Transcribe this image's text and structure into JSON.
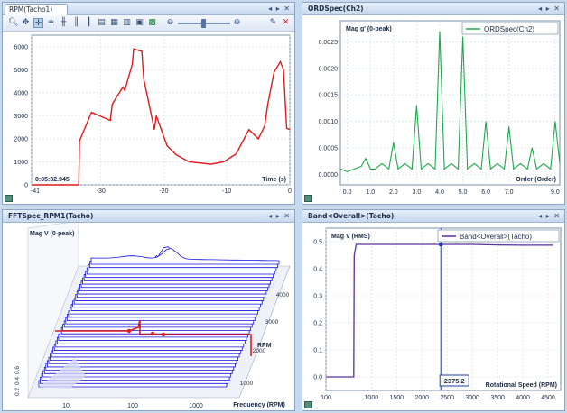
{
  "panes": {
    "rpm": {
      "tab": "RPM(Tacho1)",
      "timestamp": "0:05:32.945",
      "xlabel": "Time (s)",
      "xticks": [
        "-41",
        "-30",
        "-20",
        "-10",
        "0"
      ],
      "yticks": [
        "6000",
        "5000",
        "4000",
        "3000",
        "2000",
        "1000",
        "0"
      ],
      "line_color": "#e01b1b"
    },
    "ord": {
      "tab": "ORDSpec(Ch2)",
      "ylabel": "Mag g' (0-peak)",
      "legend": "ORDSpec(Ch2)",
      "xlabel": "Order (Order)",
      "xticks": [
        "0.0",
        "1.0",
        "2.0",
        "3.0",
        "4.0",
        "5.0",
        "6.0",
        "7.0",
        "9.0"
      ],
      "yticks": [
        "0.0025",
        "0.0020",
        "0.0015",
        "0.0010",
        "0.0005",
        "0.0000"
      ],
      "line_color": "#1ea84a"
    },
    "fft": {
      "tab": "FFTSpec_RPM1(Tacho)",
      "ylabel": "Mag V (0-peak)",
      "xlabel": "Frequency (RPM)",
      "xticks": [
        "10",
        "100",
        "1000"
      ],
      "zlabel": "RPM",
      "zticks": [
        "4000",
        "3000",
        "2000",
        "1000"
      ],
      "yticks": [
        "0.6",
        "0.4",
        "0.2"
      ],
      "waterfall_color": "#1010e0",
      "marker_color": "#e01b1b"
    },
    "band": {
      "tab": "Band<Overall>(Tacho)",
      "ylabel": "Mag V (RMS)",
      "legend": "Band<Overall>(Tacho)",
      "xlabel": "Rotational Speed (RPM)",
      "xticks": [
        "100",
        "1000",
        "1500",
        "2000",
        "2500",
        "3000",
        "3500",
        "4000",
        "4500"
      ],
      "yticks": [
        "0.5",
        "0.4",
        "0.3",
        "0.2",
        "0.1",
        "0.0"
      ],
      "cursor_value": "2375.2",
      "line_color": "#5a2fa0"
    }
  },
  "toolbar": {
    "icons": [
      "zoom-icon",
      "pan-icon",
      "cursor-icon",
      "cross-icon",
      "peak-icon",
      "harmonic-icon",
      "band-icon",
      "copy-icon",
      "export-icon",
      "print-icon",
      "excel-icon",
      "zoom-out-icon",
      "zoom-slider",
      "zoom-in-icon",
      "pin-icon",
      "close-icon"
    ]
  },
  "chart_data": [
    {
      "type": "line",
      "title": "RPM(Tacho1)",
      "xlabel": "Time (s)",
      "ylabel": "",
      "xlim": [
        -41,
        0
      ],
      "ylim": [
        0,
        6500
      ],
      "series": [
        {
          "name": "RPM",
          "x": [
            -41,
            -33.5,
            -33.4,
            -31.5,
            -28.5,
            -28.2,
            -26.5,
            -26.2,
            -25,
            -24.8,
            -23.5,
            -23.2,
            -21.5,
            -21.2,
            -19.5,
            -18,
            -16,
            -12.5,
            -10.5,
            -8.5,
            -6.5,
            -5,
            -4,
            -3.5,
            -2.5,
            -1.5,
            -1,
            -0.5,
            0
          ],
          "y": [
            0,
            0,
            1900,
            3150,
            2800,
            3500,
            4250,
            4100,
            5250,
            5900,
            5800,
            4600,
            2400,
            3000,
            1700,
            1300,
            1000,
            900,
            1000,
            1350,
            2400,
            2000,
            2550,
            3500,
            4900,
            5350,
            5000,
            2450,
            2400
          ]
        }
      ]
    },
    {
      "type": "line",
      "title": "ORDSpec(Ch2)",
      "xlabel": "Order (Order)",
      "ylabel": "Mag g' (0-peak)",
      "xlim": [
        -0.3,
        9.2
      ],
      "ylim": [
        -0.0002,
        0.0029
      ],
      "series": [
        {
          "name": "ORDSpec(Ch2)",
          "x": [
            -0.3,
            0.0,
            0.3,
            0.6,
            0.8,
            1.0,
            1.2,
            1.5,
            1.8,
            2.0,
            2.2,
            2.5,
            2.8,
            3.0,
            3.2,
            3.5,
            3.8,
            4.0,
            4.2,
            4.5,
            4.8,
            5.0,
            5.2,
            5.5,
            5.8,
            6.0,
            6.2,
            6.5,
            6.8,
            7.0,
            7.2,
            7.5,
            7.8,
            8.0,
            8.2,
            8.5,
            8.8,
            9.0,
            9.2
          ],
          "y": [
            0.0001,
            5e-05,
            0.0001,
            0.00015,
            0.0003,
            0.0001,
            0.0001,
            0.0002,
            0.0001,
            0.0006,
            0.0001,
            0.0002,
            0.0001,
            0.0013,
            0.0001,
            0.0002,
            0.0001,
            0.0027,
            0.0001,
            0.0002,
            0.0001,
            0.0026,
            0.0001,
            0.0002,
            0.0001,
            0.001,
            0.0001,
            0.0002,
            0.0001,
            0.0009,
            0.0001,
            0.0002,
            0.0001,
            0.0005,
            0.0001,
            0.0002,
            0.0001,
            0.001,
            0.0002
          ]
        }
      ]
    },
    {
      "type": "area",
      "title": "FFTSpec_RPM1(Tacho)",
      "xlabel": "Frequency (RPM)",
      "ylabel": "Mag V (0-peak)",
      "zlabel": "RPM",
      "xlim": [
        10,
        1000
      ],
      "ylim": [
        0,
        0.6
      ],
      "zlim": [
        1000,
        4000
      ],
      "series": [
        {
          "name": "FFTSpec_RPM1(Tacho)",
          "x": [
            10,
            30,
            60,
            100,
            150,
            200,
            300,
            500,
            1000
          ],
          "values": [
            0.02,
            0.05,
            0.1,
            0.25,
            0.45,
            0.3,
            0.1,
            0.04,
            0.02
          ]
        }
      ]
    },
    {
      "type": "line",
      "title": "Band<Overall>(Tacho)",
      "xlabel": "Rotational Speed (RPM)",
      "ylabel": "Mag V (RMS)",
      "xlim": [
        100,
        4750
      ],
      "ylim": [
        -0.05,
        0.55
      ],
      "series": [
        {
          "name": "Band<Overall>(Tacho)",
          "x": [
            100,
            650,
            660,
            700,
            1000,
            1500,
            2000,
            2375.2,
            2500,
            3000,
            3500,
            4000,
            4600
          ],
          "y": [
            0.0,
            0.0,
            0.45,
            0.49,
            0.49,
            0.49,
            0.49,
            0.49,
            0.49,
            0.49,
            0.488,
            0.487,
            0.487
          ]
        }
      ],
      "cursor_x": 2375.2
    }
  ]
}
